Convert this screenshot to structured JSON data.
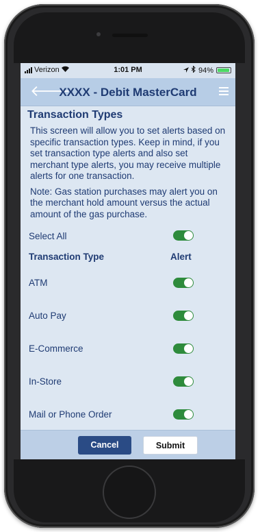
{
  "status_bar": {
    "carrier": "Verizon",
    "time": "1:01 PM",
    "battery": "94%",
    "battery_level": 0.94
  },
  "nav": {
    "title": "XXXX - Debit MasterCard"
  },
  "page": {
    "title": "Transaction Types",
    "description": "This screen will allow you to set alerts based on specific transaction types. Keep in mind, if you set transaction type alerts and also set merchant type alerts, you may receive multiple alerts for one transaction.",
    "note": "Note: Gas station purchases may alert you on the merchant hold amount versus the actual amount of the gas purchase."
  },
  "select_all": {
    "label": "Select All",
    "enabled": true
  },
  "table": {
    "column_type": "Transaction Type",
    "column_alert": "Alert",
    "rows": [
      {
        "label": "ATM",
        "enabled": true
      },
      {
        "label": "Auto Pay",
        "enabled": true
      },
      {
        "label": "E-Commerce",
        "enabled": true
      },
      {
        "label": "In-Store",
        "enabled": true
      },
      {
        "label": "Mail or Phone Order",
        "enabled": true
      }
    ]
  },
  "actions": {
    "cancel": "Cancel",
    "submit": "Submit"
  },
  "colors": {
    "accent": "#1f3b73",
    "toggle_on": "#2e8b3c",
    "nav_bg": "#b7cde6"
  }
}
